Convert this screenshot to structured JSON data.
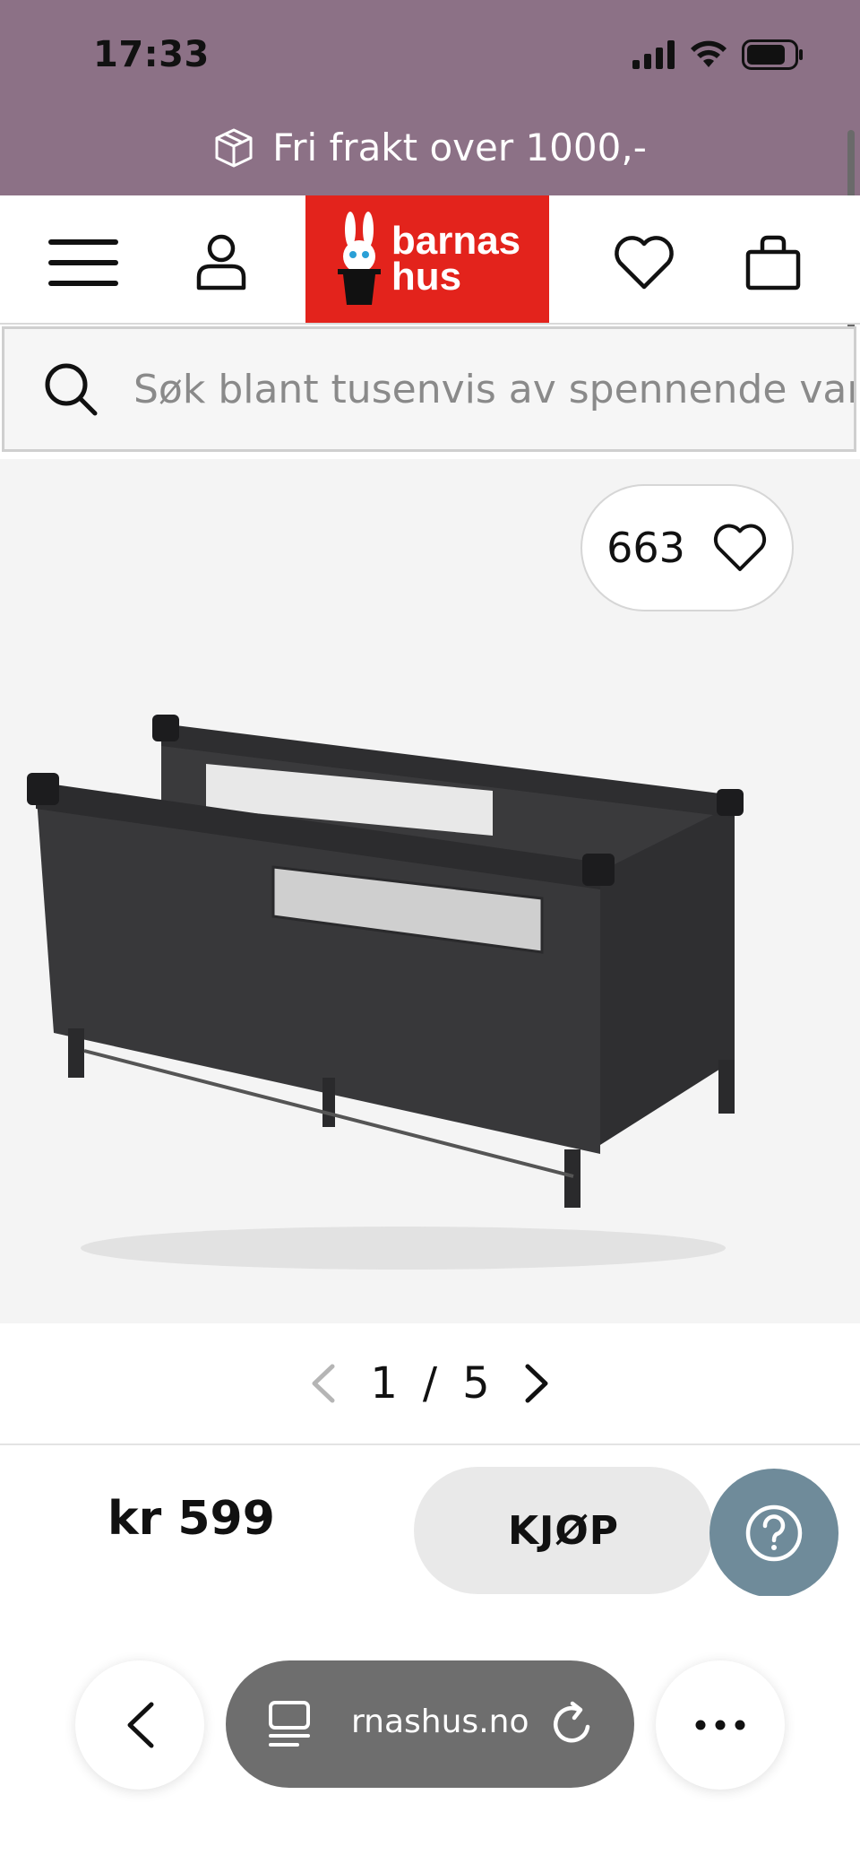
{
  "status_bar": {
    "time": "17:33"
  },
  "promo": {
    "text": "Fri frakt over 1000,-",
    "icon": "box-icon",
    "background": "#8c7186"
  },
  "header": {
    "menu_icon": "hamburger-menu-icon",
    "account_icon": "user-icon",
    "logo": {
      "line1": "barnas",
      "line2": "hus",
      "background": "#e3231c"
    },
    "wishlist_icon": "heart-icon",
    "cart_icon": "shopping-bag-icon"
  },
  "search": {
    "placeholder": "Søk blant tusenvis av spennende varer",
    "icon": "search-icon"
  },
  "gallery": {
    "like_count": "663",
    "pager": {
      "current": "1",
      "separator": "/",
      "total": "5"
    }
  },
  "purchase": {
    "price": "kr 599",
    "buy_label": "KJØP",
    "help_color": "#6f8b9a"
  },
  "browser": {
    "url_text": "rnashus.no"
  }
}
